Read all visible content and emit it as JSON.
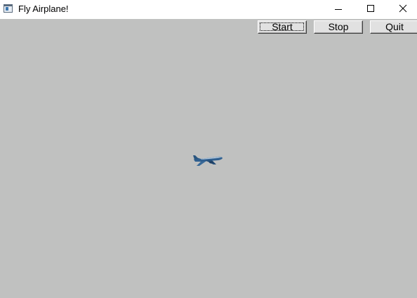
{
  "window": {
    "title": "Fly  Airplane!",
    "icon": "app-window-icon",
    "controls": [
      "minimize-icon",
      "maximize-icon",
      "close-icon"
    ]
  },
  "toolbar": {
    "start_label": "Start",
    "stop_label": "Stop",
    "quit_label": "Quit"
  },
  "canvas": {
    "background": "#c0c1c0",
    "sprite": "airplane-icon",
    "sprite_color": "#2f5f8f"
  }
}
